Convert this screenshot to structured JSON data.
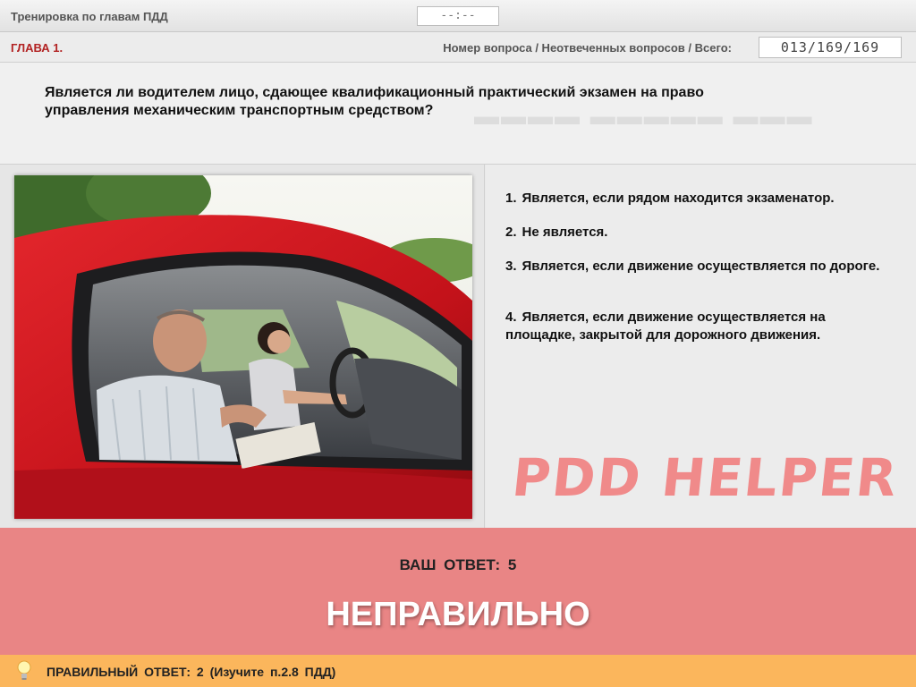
{
  "header": {
    "app_title": "Тренировка по главам ПДД",
    "timer": "--:--"
  },
  "chapter": {
    "label": "ГЛАВА 1.",
    "counter_label": "Номер вопроса / Неотвеченных вопросов / Всего:",
    "counter_value": "013/169/169"
  },
  "question": {
    "text": "Является ли водителем лицо, сдающее квалификационный практический экзамен на право управления механическим транспортным средством?"
  },
  "answers": [
    {
      "num": "1.",
      "text": "Является, если рядом находится экзаменатор."
    },
    {
      "num": "2.",
      "text": "Не является."
    },
    {
      "num": "3.",
      "text": "Является, если движение осуществляется по дороге."
    },
    {
      "num": "4.",
      "text": "Является, если движение осуществляется на площадке, закрытой для дорожного движения."
    }
  ],
  "watermark": "PDD HELPER",
  "result": {
    "your_answer": "ВАШ ОТВЕТ: 5",
    "verdict": "НЕПРАВИЛЬНО"
  },
  "hint": {
    "text": "ПРАВИЛЬНЫЙ ОТВЕТ: 2 (Изучите п.2.8 ПДД)"
  },
  "colors": {
    "result_bg": "#e98585",
    "hint_bg": "#fbb65c",
    "chapter_label": "#b22222",
    "watermark": "#f08a8a"
  }
}
